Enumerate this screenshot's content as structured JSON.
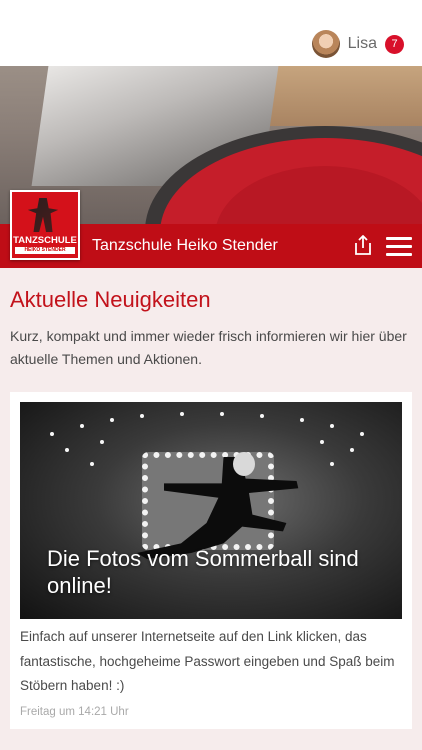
{
  "user": {
    "name": "Lisa",
    "notification_count": "7"
  },
  "brand": {
    "name": "Tanzschule Heiko Stender",
    "logo_line1": "TANZSCHULE",
    "logo_line2": "HEIKO STENDER"
  },
  "section": {
    "title": "Aktuelle Neuigkeiten",
    "intro": "Kurz, kompakt und immer wieder frisch informieren wir hier über aktuelle Themen und Aktionen."
  },
  "news": [
    {
      "title": "Die Fotos vom Sommerball sind online!",
      "text": "Einfach auf unserer Internetseite auf den Link klicken, das fantastische, hochgeheime Passwort eingeben und Spaß beim Stöbern haben! :)",
      "time": "Freitag um 14:21 Uhr"
    }
  ],
  "icons": {
    "share": "share-icon",
    "menu": "hamburger-menu-icon",
    "avatar": "user-avatar"
  },
  "colors": {
    "brand_red": "#bf0d16",
    "title_red": "#c2121b",
    "badge_red": "#d8102a",
    "page_bg": "#f6ecec"
  }
}
